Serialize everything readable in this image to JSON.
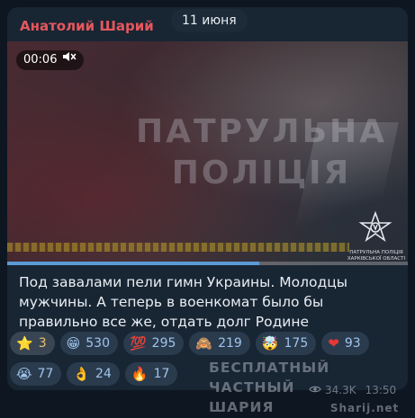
{
  "message": {
    "sender": "Анатолий Шарий",
    "date_label": "11 июня",
    "video": {
      "time": "00:06",
      "watermark_line1": "ПАТРУЛЬНА",
      "watermark_line2": "ПОЛІЦІЯ",
      "logo_caption_line1": "ПАТРУЛЬНА ПОЛІЦІЯ",
      "logo_caption_line2": "ХАРКІВСЬКОЇ ОБЛАСТІ",
      "progress": 0.63
    },
    "text": "Под завалами пели гимн Украины. Молодцы мужчины. А теперь в военкомат было бы правильно все же, отдать долг Родине",
    "views": "34.3K",
    "time": "13:50"
  },
  "reactions": [
    {
      "emoji": "⭐",
      "count": "3",
      "icon": "star-icon"
    },
    {
      "emoji": "😁",
      "count": "530",
      "icon": "grin-icon"
    },
    {
      "emoji": "💯",
      "count": "295",
      "icon": "hundred-icon"
    },
    {
      "emoji": "🙈",
      "count": "219",
      "icon": "see-no-evil-monkey-icon"
    },
    {
      "emoji": "🤯",
      "count": "175",
      "icon": "mind-blown-icon"
    },
    {
      "emoji": "❤",
      "count": "93",
      "icon": "heart-icon"
    },
    {
      "emoji": "😭",
      "count": "77",
      "icon": "crying-icon"
    },
    {
      "emoji": "👌",
      "count": "24",
      "icon": "ok-hand-icon"
    },
    {
      "emoji": "🔥",
      "count": "17",
      "icon": "fire-icon"
    }
  ],
  "overlay": {
    "brand_line1": "БЕСПЛАТНЫЙ ЧАСТНЫЙ",
    "brand_line2": "ШАРИЯ",
    "brand_site": "Sharij.net"
  },
  "colors": {
    "sender": "#e5575d",
    "accent": "#5b9bd5",
    "bubble": "#182533"
  }
}
